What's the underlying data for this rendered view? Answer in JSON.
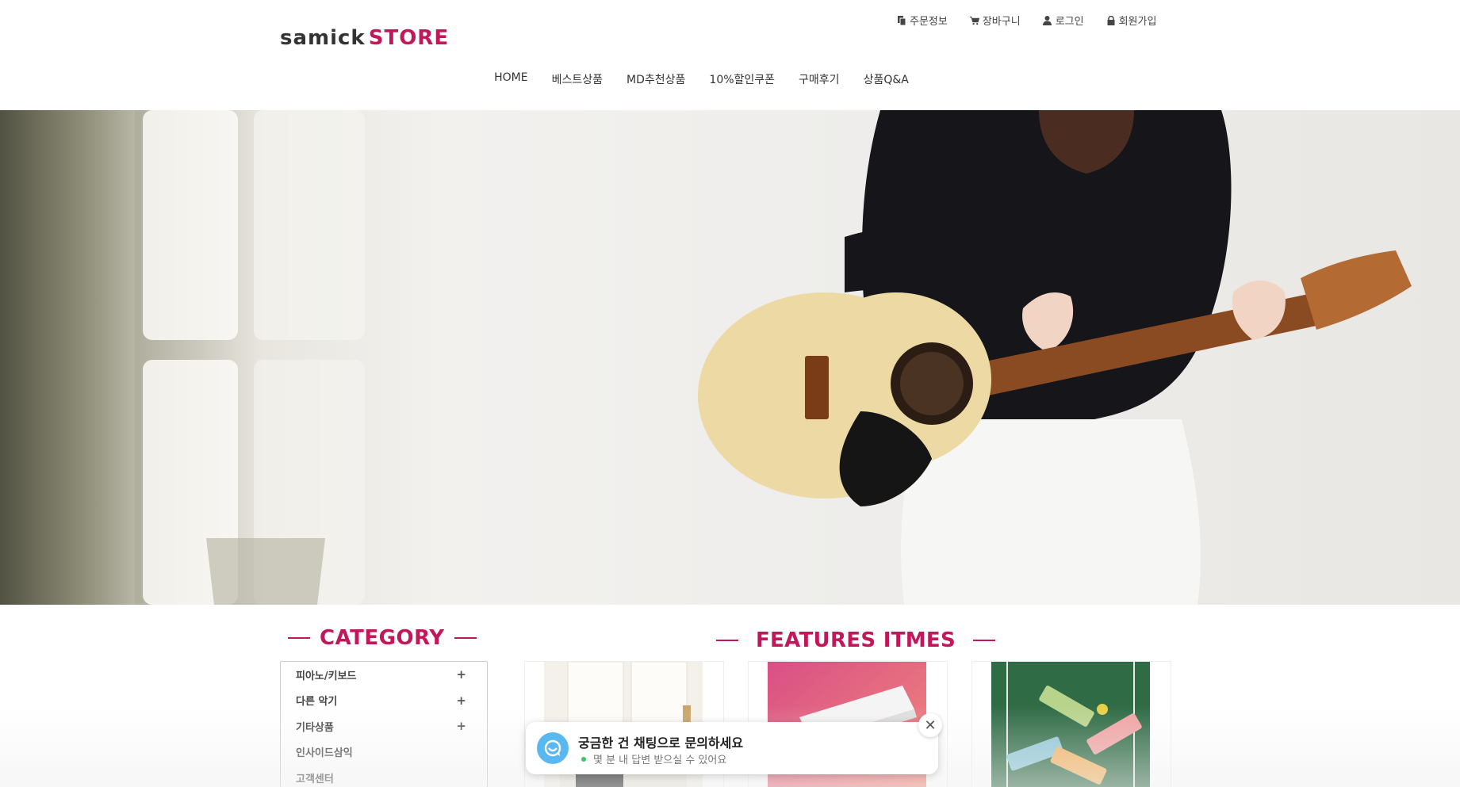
{
  "header": {
    "logo_brand": "samick",
    "logo_store": "STORE",
    "util_nav": [
      {
        "label": "주문정보",
        "icon": "order-icon"
      },
      {
        "label": "장바구니",
        "icon": "cart-icon"
      },
      {
        "label": "로그인",
        "icon": "user-icon"
      },
      {
        "label": "회원가입",
        "icon": "lock-icon"
      }
    ],
    "gnb": [
      "HOME",
      "베스트상품",
      "MD추천상품",
      "10%할인쿠폰",
      "구매후기",
      "상품Q&A"
    ]
  },
  "hero": {
    "description_icon": "guitar-banner-image"
  },
  "category": {
    "title": "CATEGORY",
    "items": [
      {
        "label": "피아노/키보드",
        "expandable": true
      },
      {
        "label": "다른 악기",
        "expandable": true
      },
      {
        "label": "기타상품",
        "expandable": true
      },
      {
        "label": "인사이드삼익",
        "expandable": false
      },
      {
        "label": "고객센터",
        "expandable": false
      }
    ]
  },
  "features": {
    "title": "FEATURES ITMES"
  },
  "chat": {
    "title": "궁금한 건 채팅으로 문의하세요",
    "subtitle": "몇 분 내 답변 받으실 수 있어요",
    "close_label": "✕"
  },
  "colors": {
    "accent": "#c2185b",
    "chat_avatar": "#5ab8f0",
    "online_dot": "#3ac46b"
  }
}
